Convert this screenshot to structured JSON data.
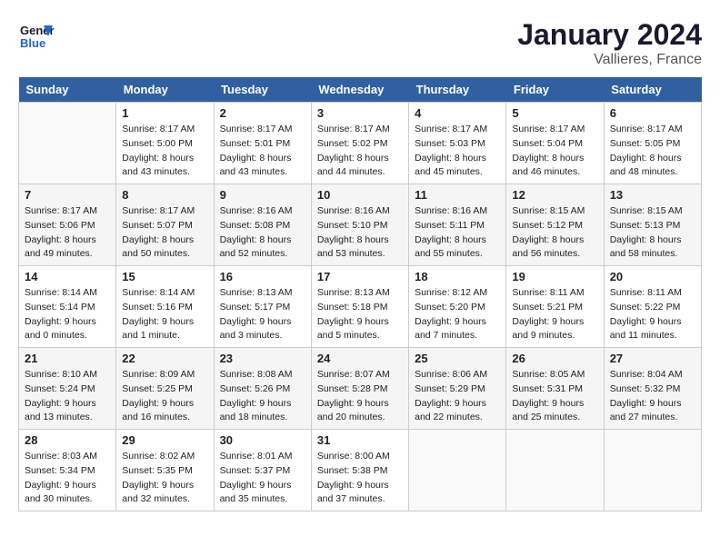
{
  "header": {
    "logo_line1": "General",
    "logo_line2": "Blue",
    "month": "January 2024",
    "location": "Vallieres, France"
  },
  "days_of_week": [
    "Sunday",
    "Monday",
    "Tuesday",
    "Wednesday",
    "Thursday",
    "Friday",
    "Saturday"
  ],
  "weeks": [
    [
      {
        "num": "",
        "sunrise": "",
        "sunset": "",
        "daylight": "",
        "empty": true
      },
      {
        "num": "1",
        "sunrise": "Sunrise: 8:17 AM",
        "sunset": "Sunset: 5:00 PM",
        "daylight": "Daylight: 8 hours and 43 minutes."
      },
      {
        "num": "2",
        "sunrise": "Sunrise: 8:17 AM",
        "sunset": "Sunset: 5:01 PM",
        "daylight": "Daylight: 8 hours and 43 minutes."
      },
      {
        "num": "3",
        "sunrise": "Sunrise: 8:17 AM",
        "sunset": "Sunset: 5:02 PM",
        "daylight": "Daylight: 8 hours and 44 minutes."
      },
      {
        "num": "4",
        "sunrise": "Sunrise: 8:17 AM",
        "sunset": "Sunset: 5:03 PM",
        "daylight": "Daylight: 8 hours and 45 minutes."
      },
      {
        "num": "5",
        "sunrise": "Sunrise: 8:17 AM",
        "sunset": "Sunset: 5:04 PM",
        "daylight": "Daylight: 8 hours and 46 minutes."
      },
      {
        "num": "6",
        "sunrise": "Sunrise: 8:17 AM",
        "sunset": "Sunset: 5:05 PM",
        "daylight": "Daylight: 8 hours and 48 minutes."
      }
    ],
    [
      {
        "num": "7",
        "sunrise": "Sunrise: 8:17 AM",
        "sunset": "Sunset: 5:06 PM",
        "daylight": "Daylight: 8 hours and 49 minutes."
      },
      {
        "num": "8",
        "sunrise": "Sunrise: 8:17 AM",
        "sunset": "Sunset: 5:07 PM",
        "daylight": "Daylight: 8 hours and 50 minutes."
      },
      {
        "num": "9",
        "sunrise": "Sunrise: 8:16 AM",
        "sunset": "Sunset: 5:08 PM",
        "daylight": "Daylight: 8 hours and 52 minutes."
      },
      {
        "num": "10",
        "sunrise": "Sunrise: 8:16 AM",
        "sunset": "Sunset: 5:10 PM",
        "daylight": "Daylight: 8 hours and 53 minutes."
      },
      {
        "num": "11",
        "sunrise": "Sunrise: 8:16 AM",
        "sunset": "Sunset: 5:11 PM",
        "daylight": "Daylight: 8 hours and 55 minutes."
      },
      {
        "num": "12",
        "sunrise": "Sunrise: 8:15 AM",
        "sunset": "Sunset: 5:12 PM",
        "daylight": "Daylight: 8 hours and 56 minutes."
      },
      {
        "num": "13",
        "sunrise": "Sunrise: 8:15 AM",
        "sunset": "Sunset: 5:13 PM",
        "daylight": "Daylight: 8 hours and 58 minutes."
      }
    ],
    [
      {
        "num": "14",
        "sunrise": "Sunrise: 8:14 AM",
        "sunset": "Sunset: 5:14 PM",
        "daylight": "Daylight: 9 hours and 0 minutes."
      },
      {
        "num": "15",
        "sunrise": "Sunrise: 8:14 AM",
        "sunset": "Sunset: 5:16 PM",
        "daylight": "Daylight: 9 hours and 1 minute."
      },
      {
        "num": "16",
        "sunrise": "Sunrise: 8:13 AM",
        "sunset": "Sunset: 5:17 PM",
        "daylight": "Daylight: 9 hours and 3 minutes."
      },
      {
        "num": "17",
        "sunrise": "Sunrise: 8:13 AM",
        "sunset": "Sunset: 5:18 PM",
        "daylight": "Daylight: 9 hours and 5 minutes."
      },
      {
        "num": "18",
        "sunrise": "Sunrise: 8:12 AM",
        "sunset": "Sunset: 5:20 PM",
        "daylight": "Daylight: 9 hours and 7 minutes."
      },
      {
        "num": "19",
        "sunrise": "Sunrise: 8:11 AM",
        "sunset": "Sunset: 5:21 PM",
        "daylight": "Daylight: 9 hours and 9 minutes."
      },
      {
        "num": "20",
        "sunrise": "Sunrise: 8:11 AM",
        "sunset": "Sunset: 5:22 PM",
        "daylight": "Daylight: 9 hours and 11 minutes."
      }
    ],
    [
      {
        "num": "21",
        "sunrise": "Sunrise: 8:10 AM",
        "sunset": "Sunset: 5:24 PM",
        "daylight": "Daylight: 9 hours and 13 minutes."
      },
      {
        "num": "22",
        "sunrise": "Sunrise: 8:09 AM",
        "sunset": "Sunset: 5:25 PM",
        "daylight": "Daylight: 9 hours and 16 minutes."
      },
      {
        "num": "23",
        "sunrise": "Sunrise: 8:08 AM",
        "sunset": "Sunset: 5:26 PM",
        "daylight": "Daylight: 9 hours and 18 minutes."
      },
      {
        "num": "24",
        "sunrise": "Sunrise: 8:07 AM",
        "sunset": "Sunset: 5:28 PM",
        "daylight": "Daylight: 9 hours and 20 minutes."
      },
      {
        "num": "25",
        "sunrise": "Sunrise: 8:06 AM",
        "sunset": "Sunset: 5:29 PM",
        "daylight": "Daylight: 9 hours and 22 minutes."
      },
      {
        "num": "26",
        "sunrise": "Sunrise: 8:05 AM",
        "sunset": "Sunset: 5:31 PM",
        "daylight": "Daylight: 9 hours and 25 minutes."
      },
      {
        "num": "27",
        "sunrise": "Sunrise: 8:04 AM",
        "sunset": "Sunset: 5:32 PM",
        "daylight": "Daylight: 9 hours and 27 minutes."
      }
    ],
    [
      {
        "num": "28",
        "sunrise": "Sunrise: 8:03 AM",
        "sunset": "Sunset: 5:34 PM",
        "daylight": "Daylight: 9 hours and 30 minutes."
      },
      {
        "num": "29",
        "sunrise": "Sunrise: 8:02 AM",
        "sunset": "Sunset: 5:35 PM",
        "daylight": "Daylight: 9 hours and 32 minutes."
      },
      {
        "num": "30",
        "sunrise": "Sunrise: 8:01 AM",
        "sunset": "Sunset: 5:37 PM",
        "daylight": "Daylight: 9 hours and 35 minutes."
      },
      {
        "num": "31",
        "sunrise": "Sunrise: 8:00 AM",
        "sunset": "Sunset: 5:38 PM",
        "daylight": "Daylight: 9 hours and 37 minutes."
      },
      {
        "num": "",
        "sunrise": "",
        "sunset": "",
        "daylight": "",
        "empty": true
      },
      {
        "num": "",
        "sunrise": "",
        "sunset": "",
        "daylight": "",
        "empty": true
      },
      {
        "num": "",
        "sunrise": "",
        "sunset": "",
        "daylight": "",
        "empty": true
      }
    ]
  ]
}
